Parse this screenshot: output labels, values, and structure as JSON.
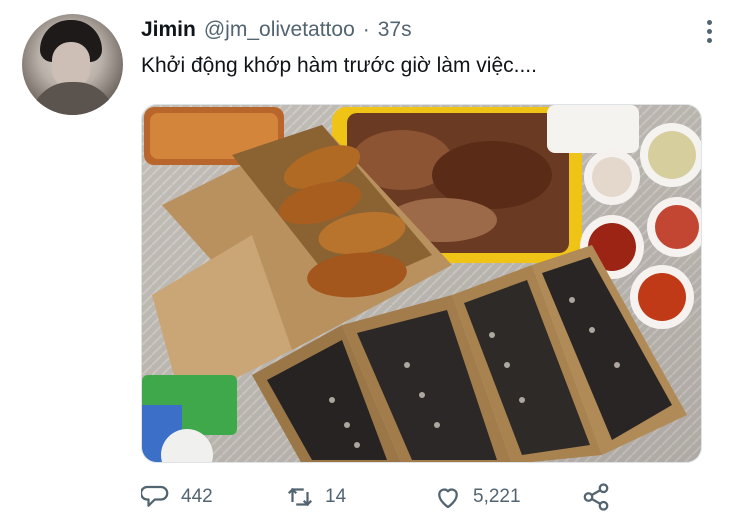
{
  "tweet": {
    "author_name": "Jimin",
    "handle": "@jm_olivetattoo",
    "separator": "·",
    "time": "37s",
    "text": "Khởi động khớp hàm trước giờ làm việc....",
    "avatar_icon": "profile-photo",
    "more_icon": "more-vertical-icon"
  },
  "actions": {
    "reply_count": "442",
    "retweet_count": "14",
    "like_count": "5,221",
    "reply_icon": "comment-bubble-icon",
    "retweet_icon": "retweet-icon",
    "like_icon": "heart-icon",
    "share_icon": "share-icon"
  },
  "colors": {
    "text": "#0f1419",
    "secondary": "#536471"
  }
}
